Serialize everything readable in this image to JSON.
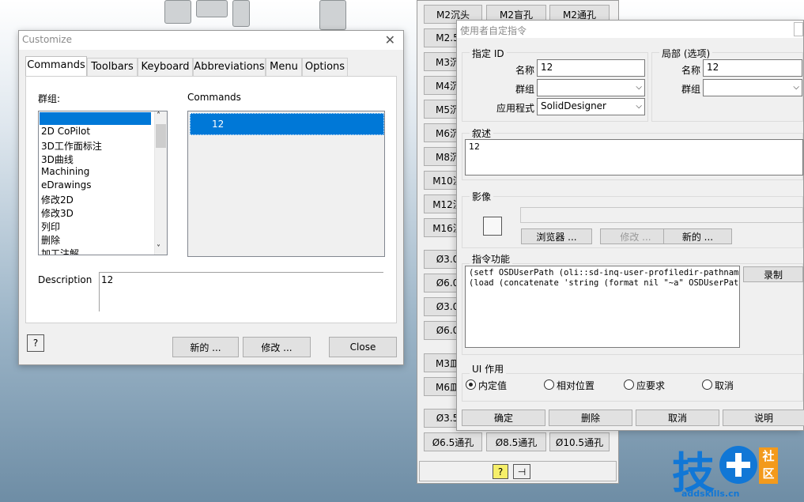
{
  "customize": {
    "title": "Customize",
    "tabs": [
      {
        "label": "Commands"
      },
      {
        "label": "Toolbars"
      },
      {
        "label": "Keyboard"
      },
      {
        "label": "Abbreviations"
      },
      {
        "label": "Menu"
      },
      {
        "label": "Options"
      }
    ],
    "group_label": "群组:",
    "groups": [
      "",
      "2D CoPilot",
      "3D工作面标注",
      "3D曲线",
      "Machining",
      "eDrawings",
      "修改2D",
      "修改3D",
      "列印",
      "删除",
      "加工注解"
    ],
    "commands_label": "Commands",
    "commands": [
      "12"
    ],
    "description_label": "Description",
    "description_value": "12",
    "buttons": {
      "new": "新的 ...",
      "modify": "修改 ...",
      "close": "Close"
    }
  },
  "palette": {
    "top_row": [
      "M2沉头",
      "M2盲孔",
      "M2通孔"
    ],
    "left_col": [
      "M2.5",
      "M3沉",
      "M4沉",
      "M5沉",
      "M6沉",
      "M8沉",
      "M10沉",
      "M12沉",
      "M16沉",
      "Ø3.0",
      "Ø6.0",
      "Ø3.0",
      "Ø6.0",
      "M3皿",
      "M6皿",
      "Ø3.5"
    ],
    "bottom_row": [
      "Ø6.5通孔",
      "Ø8.5通孔",
      "Ø10.5通孔"
    ]
  },
  "userdlg": {
    "title": "使用者自定指令",
    "id_group": "指定 ID",
    "name_label": "名称",
    "name_value": "12",
    "group_label": "群组",
    "group_value": "",
    "app_label": "应用程式",
    "app_value": "SolidDesigner",
    "local_group": "局部 (选项)",
    "local_name_label": "名称",
    "local_name_value": "12",
    "local_group_label": "群组",
    "local_group_value": "",
    "desc_group": "叙述",
    "desc_value": "12",
    "image_group": "影像",
    "image_buttons": {
      "browse": "浏览器 ...",
      "modify": "修改 ...",
      "new": "新的 ..."
    },
    "func_group": "指令功能",
    "func_lines": [
      "(setf OSDUserPath (oli::sd-inq-user-profiledir-pathname))",
      "(load (concatenate 'string (format nil \"~a\" OSDUserPath) \""
    ],
    "record_button": "录制",
    "ui_group": "UI 作用",
    "radios": [
      {
        "label": "内定值",
        "checked": true
      },
      {
        "label": "相对位置",
        "checked": false
      },
      {
        "label": "应要求",
        "checked": false
      },
      {
        "label": "取消",
        "checked": false
      }
    ],
    "bottom_buttons": {
      "ok": "确定",
      "delete": "删除",
      "cancel": "取消",
      "help": "说明"
    }
  },
  "watermark": {
    "logo_char": "技",
    "badge_top": "社",
    "badge_bottom": "区",
    "site": "addskills.cn"
  },
  "colors": {
    "selection": "#0078d7",
    "logo_blue": "#1177d6",
    "logo_orange": "#f39a1c"
  }
}
